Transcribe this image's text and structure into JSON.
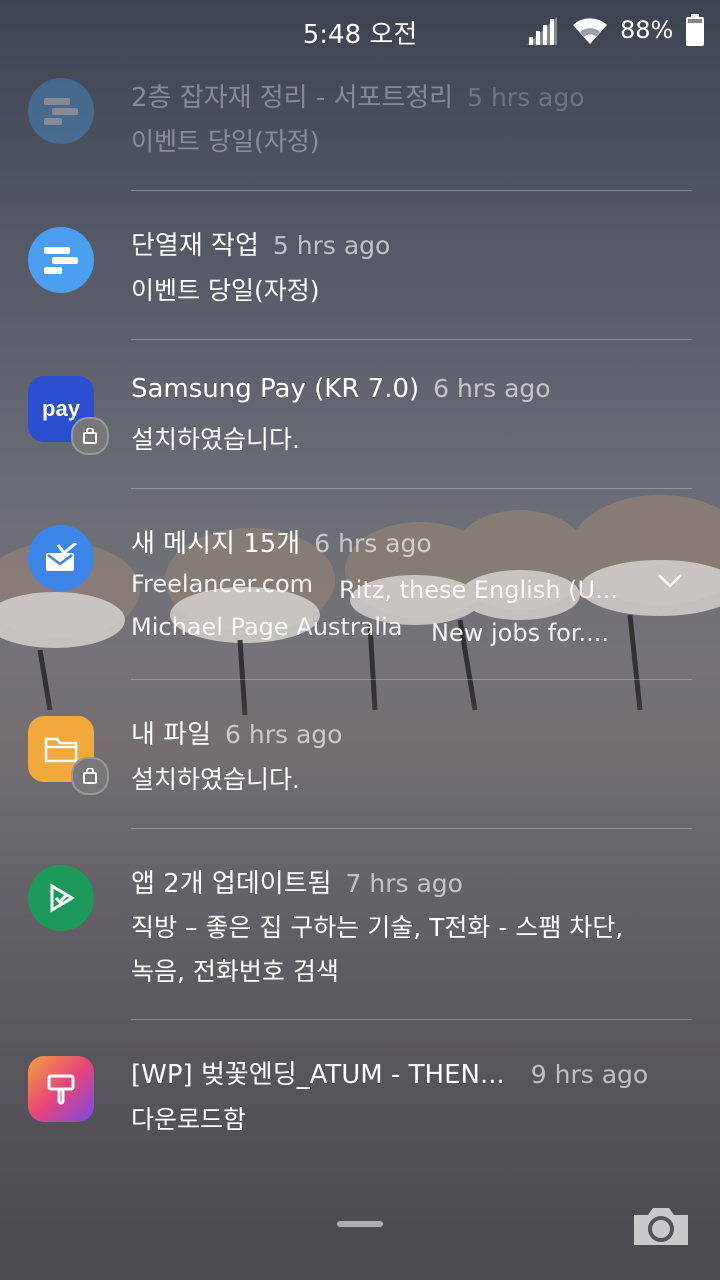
{
  "status_bar": {
    "time": "5:48 오전",
    "battery": "88%",
    "icons": [
      "signal-icon",
      "wifi-icon",
      "battery-icon"
    ]
  },
  "notifications": [
    {
      "title": "2층 잡자재 정리 - 서포트정리",
      "time": "5 hrs ago",
      "body": "이벤트 당일(자정)",
      "icon": "calendar-bars-icon",
      "faded": true
    },
    {
      "title": "단열재 작업",
      "time": "5 hrs ago",
      "body": "이벤트 당일(자정)",
      "icon": "calendar-bars-icon"
    },
    {
      "title": "Samsung Pay (KR 7.0)",
      "time": "6 hrs ago",
      "body": "설치하였습니다.",
      "icon": "samsung-pay-icon",
      "icon_text": "pay",
      "badge": "shopping-bag-icon"
    },
    {
      "title": "새 메시지 15개",
      "time": "6 hrs ago",
      "icon": "email-icon",
      "messages": [
        {
          "sender": "Freelancer.com",
          "text": "Ritz, these English (U..."
        },
        {
          "sender": "Michael Page Australia",
          "text": "New jobs for...."
        }
      ]
    },
    {
      "title": "내 파일",
      "time": "6 hrs ago",
      "body": "설치하였습니다.",
      "icon": "folder-icon",
      "badge": "shopping-bag-icon"
    },
    {
      "title": "앱 2개 업데이트됨",
      "time": "7 hrs ago",
      "body_lines": [
        "직방 – 좋은 집 구하는 기술, T전화 - 스팸 차단,",
        "녹음, 전화번호 검색"
      ],
      "icon": "play-store-check-icon"
    },
    {
      "title": "[WP] 벚꽃엔딩_ATUM - THEN...",
      "time": "9 hrs ago",
      "body": "다운로드함",
      "icon": "theme-brush-icon"
    }
  ],
  "colors": {
    "calendar_icon": "#4a9ff0",
    "pay_icon": "#2a4fd0",
    "email_icon": "#3d86e8",
    "folder_icon": "#f2a93b",
    "store_icon": "#1d9a5a"
  }
}
